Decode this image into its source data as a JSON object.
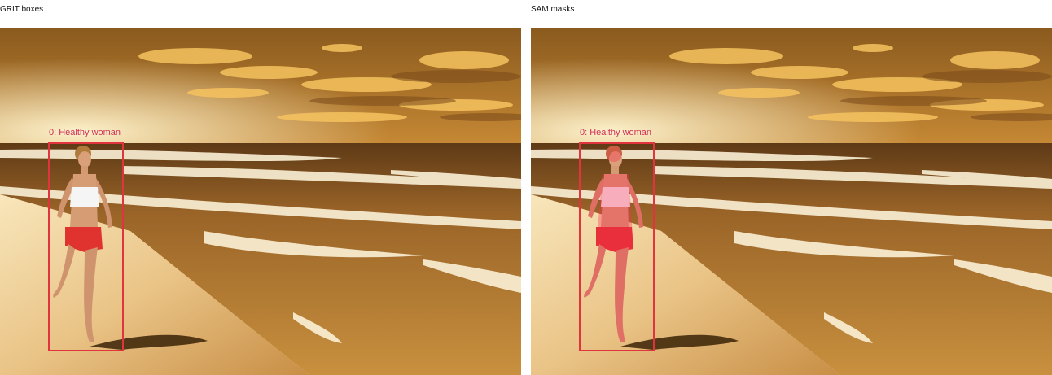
{
  "panels": [
    {
      "title": "GRIT boxes",
      "detections": [
        {
          "label": "0: Healthy woman",
          "color": "#e0343f"
        }
      ]
    },
    {
      "title": "SAM masks",
      "detections": [
        {
          "label": "0: Healthy woman",
          "color": "#e0343f"
        }
      ]
    }
  ]
}
